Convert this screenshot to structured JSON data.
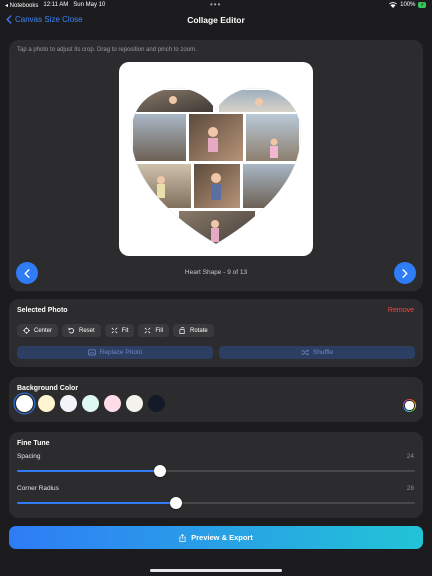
{
  "status_bar": {
    "app": "◂ Notebooks",
    "time": "12:11 AM",
    "date": "Sun May 10",
    "dots": "•••",
    "battery_pct": "100%",
    "battery_label": "⚡"
  },
  "nav": {
    "back_label": "Canvas Size Close",
    "title": "Collage Editor"
  },
  "canvas": {
    "hint": "Tap a photo to adjust its crop. Drag to reposition and pinch to zoom.",
    "layout_label": "Heart Shape - 9 of 13",
    "prev_icon": "chevron-left-icon",
    "next_icon": "chevron-right-icon"
  },
  "selected_photo": {
    "title": "Selected Photo",
    "remove_label": "Remove",
    "tools": [
      {
        "label": "Center",
        "icon": "crosshair-icon"
      },
      {
        "label": "Reset",
        "icon": "undo-icon"
      },
      {
        "label": "Fit",
        "icon": "fit-icon"
      },
      {
        "label": "Fill",
        "icon": "fill-icon"
      },
      {
        "label": "Rotate",
        "icon": "rotate-icon"
      }
    ],
    "replace_label": "Replace Photo",
    "shuffle_label": "Shuffle"
  },
  "background": {
    "title": "Background Color",
    "swatches": [
      "#ffffff",
      "#fff6d1",
      "#f3f3fb",
      "#def7f2",
      "#ffdde8",
      "#f3f3ec",
      "#151a29"
    ],
    "selected_index": 0,
    "picker_icon": "color-wheel-icon"
  },
  "fine_tune": {
    "title": "Fine Tune",
    "spacing": {
      "label": "Spacing",
      "value": "24",
      "fraction": 0.36
    },
    "corner_radius": {
      "label": "Corner Radius",
      "value": "28",
      "fraction": 0.4
    }
  },
  "export": {
    "label": "Preview & Export",
    "icon": "share-icon"
  },
  "colors": {
    "accent": "#2f7cf6",
    "destructive": "#ff453a",
    "panel": "#2c2c2e",
    "background": "#1c1c1e"
  }
}
